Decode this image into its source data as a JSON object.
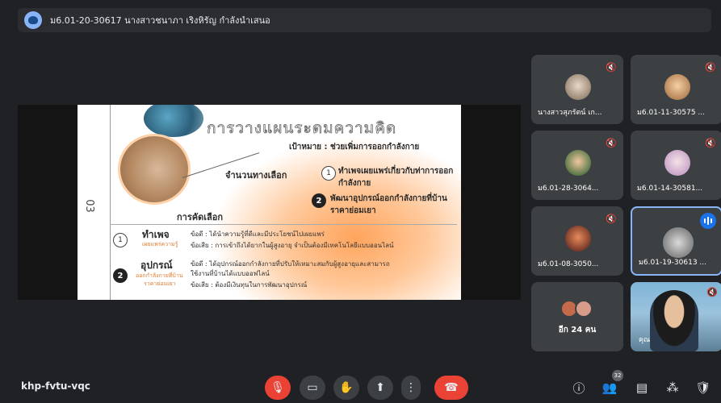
{
  "title_bar": {
    "presenter_text": "ม6.01-20-30617 นางสาวชนาภา เริงหิรัญ กำลังนำเสนอ"
  },
  "slide": {
    "page_number": "03",
    "title": "การวางแผนระดมความคิด",
    "goal": "เป้าหมาย : ช่วยเพิ่มการออกกำลังกาย",
    "options_heading": "จำนวนทางเลือก",
    "option1_num": "1",
    "option1": "ทำเพจเผยแพร่เกี่ยวกับท่าการออกกำลังกาย",
    "option2_num": "2",
    "option2": "พัฒนาอุปกรณ์ออกกำลังกายที่บ้านราคาย่อมเยา",
    "selection_heading": "การคัดเลือก",
    "choice1": {
      "num": "1",
      "title": "ทำเพจ",
      "subtitle": "เผยแพร่ความรู้",
      "pro": "ข้อดี : ได้นำความรู้ที่ดีและมีประโยชน์ไปเผยแพร่",
      "con": "ข้อเสีย : การเข้าถึงได้ยากในผู้สูงอายุ จำเป็นต้องมีเทคโนโลยีแบบออนไลน์"
    },
    "choice2": {
      "num": "2",
      "title": "อุปกรณ์",
      "subtitle1": "ออกกำลังกายที่บ้าน",
      "subtitle2": "ราคาย่อมเยา",
      "pro1": "ข้อดี : ได้อุปกรณ์ออกกำลังกายที่ปรับให้เหมาะสมกับผู้สูงอายุและสามารถ",
      "pro2": "ใช้งานที่บ้านได้แบบออฟไลน์",
      "con": "ข้อเสีย : ต้องมีเงินทุนในการพัฒนาอุปกรณ์"
    }
  },
  "participants": [
    {
      "name": "นางสาวสุภรัตน์ เก...",
      "muted": true
    },
    {
      "name": "ม6.01-11-30575 ...",
      "muted": true
    },
    {
      "name": "ม6.01-28-3064...",
      "muted": true
    },
    {
      "name": "ม6.01-14-30581...",
      "muted": true
    },
    {
      "name": "ม6.01-08-3050...",
      "muted": true
    },
    {
      "name": "ม6.01-19-30613 ...",
      "muted": false,
      "speaking": true
    }
  ],
  "others_tile": {
    "label": "อีก 24 คน"
  },
  "self_view": {
    "name": "คุณ",
    "muted": true
  },
  "bottom_bar": {
    "meeting_code": "khp-fvtu-vqc",
    "participant_count": "32"
  },
  "icons": {
    "mic_off": "mic-off-icon",
    "camera": "camera-icon",
    "raise_hand": "raise-hand-icon",
    "present": "present-screen-icon",
    "more": "more-options-icon",
    "end_call": "end-call-icon",
    "info": "info-icon",
    "people": "people-icon",
    "chat": "chat-icon",
    "activities": "activities-icon",
    "host_controls": "host-controls-icon"
  },
  "colors": {
    "background": "#202124",
    "tile": "#3c4043",
    "end_call": "#ea4335",
    "active_speaker": "#8ab4f8",
    "slide_accent": "#ffa45c"
  }
}
